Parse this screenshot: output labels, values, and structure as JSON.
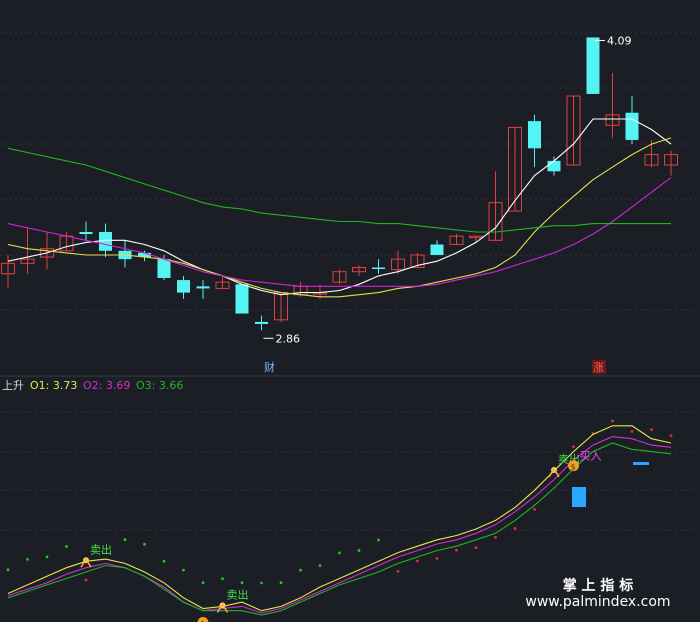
{
  "chart_data": [
    {
      "type": "candlestick",
      "panel": "main",
      "ylim": [
        2.5,
        4.25
      ],
      "grid": true,
      "candles": [
        {
          "open": 2.96,
          "close": 3.01,
          "high": 3.05,
          "low": 2.89,
          "color": "red"
        },
        {
          "open": 3.01,
          "close": 3.03,
          "high": 3.18,
          "low": 2.96,
          "color": "red"
        },
        {
          "open": 3.04,
          "close": 3.08,
          "high": 3.16,
          "low": 2.98,
          "color": "red"
        },
        {
          "open": 3.07,
          "close": 3.14,
          "high": 3.16,
          "low": 3.07,
          "color": "red"
        },
        {
          "open": 3.16,
          "close": 3.15,
          "high": 3.21,
          "low": 3.12,
          "color": "cyan"
        },
        {
          "open": 3.16,
          "close": 3.07,
          "high": 3.2,
          "low": 3.04,
          "color": "cyan"
        },
        {
          "open": 3.07,
          "close": 3.03,
          "high": 3.12,
          "low": 2.99,
          "color": "cyan"
        },
        {
          "open": 3.06,
          "close": 3.04,
          "high": 3.07,
          "low": 3.02,
          "color": "cyan"
        },
        {
          "open": 3.03,
          "close": 2.94,
          "high": 3.05,
          "low": 2.93,
          "color": "cyan"
        },
        {
          "open": 2.93,
          "close": 2.87,
          "high": 2.95,
          "low": 2.84,
          "color": "cyan"
        },
        {
          "open": 2.9,
          "close": 2.89,
          "high": 2.93,
          "low": 2.84,
          "color": "cyan"
        },
        {
          "open": 2.89,
          "close": 2.92,
          "high": 2.95,
          "low": 2.89,
          "color": "red"
        },
        {
          "open": 2.91,
          "close": 2.77,
          "high": 2.91,
          "low": 2.77,
          "color": "cyan"
        },
        {
          "open": 2.73,
          "close": 2.72,
          "high": 2.76,
          "low": 2.69,
          "color": "cyan"
        },
        {
          "open": 2.74,
          "close": 2.87,
          "high": 2.87,
          "low": 2.73,
          "color": "red"
        },
        {
          "open": 2.86,
          "close": 2.9,
          "high": 2.92,
          "low": 2.85,
          "color": "red"
        },
        {
          "open": 2.87,
          "close": 2.87,
          "high": 2.91,
          "low": 2.84,
          "color": "red"
        },
        {
          "open": 2.92,
          "close": 2.97,
          "high": 2.98,
          "low": 2.91,
          "color": "red"
        },
        {
          "open": 2.97,
          "close": 2.99,
          "high": 3.0,
          "low": 2.95,
          "color": "red"
        },
        {
          "open": 2.99,
          "close": 2.99,
          "high": 3.03,
          "low": 2.96,
          "color": "cyan"
        },
        {
          "open": 2.98,
          "close": 3.03,
          "high": 3.07,
          "low": 2.96,
          "color": "red"
        },
        {
          "open": 2.99,
          "close": 3.05,
          "high": 3.06,
          "low": 2.99,
          "color": "red"
        },
        {
          "open": 3.1,
          "close": 3.05,
          "high": 3.12,
          "low": 3.05,
          "color": "cyan"
        },
        {
          "open": 3.1,
          "close": 3.14,
          "high": 3.15,
          "low": 3.1,
          "color": "red"
        },
        {
          "open": 3.14,
          "close": 3.14,
          "high": 3.14,
          "low": 3.11,
          "color": "red"
        },
        {
          "open": 3.12,
          "close": 3.3,
          "high": 3.45,
          "low": 3.12,
          "color": "red"
        },
        {
          "open": 3.26,
          "close": 3.66,
          "high": 3.66,
          "low": 3.26,
          "color": "red"
        },
        {
          "open": 3.69,
          "close": 3.56,
          "high": 3.72,
          "low": 3.47,
          "color": "cyan"
        },
        {
          "open": 3.5,
          "close": 3.45,
          "high": 3.52,
          "low": 3.43,
          "color": "cyan"
        },
        {
          "open": 3.48,
          "close": 3.81,
          "high": 3.81,
          "low": 3.48,
          "color": "red"
        },
        {
          "open": 4.09,
          "close": 3.82,
          "high": 4.09,
          "low": 3.82,
          "color": "cyan"
        },
        {
          "open": 3.67,
          "close": 3.72,
          "high": 3.92,
          "low": 3.61,
          "color": "red"
        },
        {
          "open": 3.73,
          "close": 3.6,
          "high": 3.81,
          "low": 3.58,
          "color": "cyan"
        },
        {
          "open": 3.48,
          "close": 3.53,
          "high": 3.6,
          "low": 3.47,
          "color": "red"
        },
        {
          "open": 3.48,
          "close": 3.53,
          "high": 3.55,
          "low": 3.43,
          "color": "red"
        }
      ],
      "moving_averages": [
        {
          "color": "#ffffff",
          "values": [
            3.02,
            3.04,
            3.06,
            3.09,
            3.11,
            3.12,
            3.12,
            3.1,
            3.07,
            3.02,
            2.98,
            2.95,
            2.91,
            2.88,
            2.86,
            2.87,
            2.87,
            2.88,
            2.91,
            2.95,
            2.97,
            3.0,
            3.02,
            3.06,
            3.11,
            3.18,
            3.31,
            3.43,
            3.5,
            3.58,
            3.7,
            3.7,
            3.7,
            3.65,
            3.58
          ]
        },
        {
          "color": "#e0e04a",
          "values": [
            3.1,
            3.08,
            3.07,
            3.06,
            3.05,
            3.05,
            3.05,
            3.04,
            3.03,
            3.01,
            2.98,
            2.95,
            2.92,
            2.89,
            2.87,
            2.86,
            2.85,
            2.85,
            2.86,
            2.87,
            2.89,
            2.9,
            2.92,
            2.94,
            2.96,
            2.99,
            3.05,
            3.16,
            3.25,
            3.33,
            3.41,
            3.47,
            3.53,
            3.58,
            3.61
          ]
        },
        {
          "color": "#d024d0",
          "values": [
            3.2,
            3.18,
            3.16,
            3.14,
            3.12,
            3.1,
            3.08,
            3.06,
            3.03,
            3.0,
            2.97,
            2.95,
            2.93,
            2.92,
            2.91,
            2.9,
            2.9,
            2.9,
            2.9,
            2.9,
            2.9,
            2.9,
            2.91,
            2.93,
            2.95,
            2.97,
            3.0,
            3.03,
            3.06,
            3.1,
            3.15,
            3.21,
            3.28,
            3.35,
            3.42
          ]
        },
        {
          "color": "#22b422",
          "values": [
            3.56,
            3.54,
            3.52,
            3.5,
            3.48,
            3.45,
            3.42,
            3.39,
            3.36,
            3.33,
            3.3,
            3.28,
            3.27,
            3.25,
            3.24,
            3.23,
            3.22,
            3.21,
            3.21,
            3.2,
            3.2,
            3.19,
            3.18,
            3.17,
            3.16,
            3.16,
            3.17,
            3.18,
            3.19,
            3.19,
            3.2,
            3.2,
            3.2,
            3.2,
            3.2
          ]
        }
      ],
      "annotations": {
        "high_label": "4.09",
        "low_label": "2.86",
        "cai_label": "财",
        "zhang_label": "涨"
      }
    },
    {
      "type": "line",
      "panel": "indicator",
      "title": "上升",
      "legend": [
        {
          "name": "O1",
          "value": "3.73",
          "color": "#e8e84c"
        },
        {
          "name": "O2",
          "value": "3.69",
          "color": "#d030d0"
        },
        {
          "name": "O3",
          "value": "3.66",
          "color": "#22b422"
        }
      ],
      "ylim": [
        0,
        100
      ],
      "series": [
        {
          "name": "O1",
          "values": [
            10,
            14,
            18,
            22,
            25,
            26,
            24,
            20,
            15,
            8,
            3,
            4,
            6,
            2,
            4,
            8,
            13,
            17,
            21,
            25,
            29,
            32,
            35,
            37,
            40,
            44,
            50,
            58,
            67,
            76,
            84,
            88,
            88,
            82,
            80
          ]
        },
        {
          "name": "O2",
          "values": [
            9,
            12,
            15,
            19,
            22,
            24,
            22,
            18,
            13,
            6,
            2,
            3,
            4,
            1,
            3,
            7,
            11,
            15,
            19,
            23,
            27,
            30,
            33,
            35,
            38,
            42,
            48,
            55,
            63,
            72,
            79,
            83,
            82,
            79,
            78
          ]
        },
        {
          "name": "O3",
          "values": [
            8,
            11,
            14,
            17,
            20,
            23,
            22,
            18,
            12,
            6,
            2,
            2,
            2,
            0,
            2,
            6,
            10,
            14,
            17,
            20,
            24,
            27,
            30,
            32,
            35,
            38,
            44,
            51,
            59,
            68,
            76,
            80,
            77,
            76,
            75
          ]
        }
      ],
      "dots": {
        "green": [
          0,
          1,
          2,
          3,
          6,
          7,
          8,
          9,
          10,
          11,
          12,
          13,
          14,
          15,
          16,
          17,
          18,
          19
        ],
        "red": [
          4,
          20,
          21,
          22,
          23,
          24,
          25,
          26,
          27,
          28,
          29,
          30,
          31,
          32,
          33,
          34
        ]
      },
      "signals": [
        {
          "type": "sell",
          "index": 4,
          "label": "卖出"
        },
        {
          "type": "buy",
          "index": 10,
          "label": ""
        },
        {
          "type": "sell",
          "index": 11,
          "label": "卖出"
        },
        {
          "type": "sell",
          "index": 28,
          "label": "卖出"
        },
        {
          "type": "buy",
          "index": 29,
          "label": "买入"
        }
      ]
    }
  ],
  "watermark": {
    "line1": "掌 上 指 标",
    "line2": "www.palmindex.com"
  },
  "colors": {
    "background": "#1b1e25",
    "up_candle": "#e0413c",
    "down_candle": "#54f4f4",
    "grid": "#2c3440",
    "divider": "#3a3f48"
  }
}
